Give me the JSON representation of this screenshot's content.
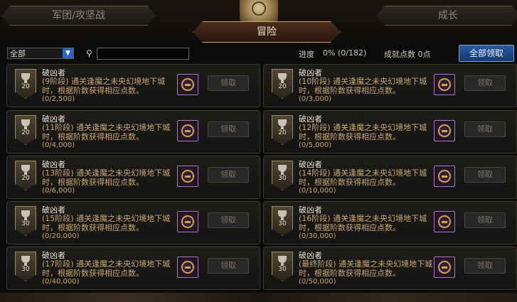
{
  "header": {
    "tab_left": "军团/攻坚战",
    "tab_right": "成长",
    "tab_active": "冒险"
  },
  "filter": {
    "select_value": "全部",
    "search_value": ""
  },
  "stats": {
    "progress_label": "进度",
    "progress_value": "0% (0/182)",
    "points_text": "成就点数 0点",
    "claim_all": "全部领取"
  },
  "cards": [
    {
      "title": "破凶者",
      "desc": "(9阶段) 通关逢魔之未央幻境地下城时，根据阶数获得相应点数。",
      "progress": "(0/2,500)",
      "badge": "20",
      "button": "领取"
    },
    {
      "title": "破凶者",
      "desc": "(10阶段) 通关逢魔之未央幻境地下城时，根据阶数获得相应点数。",
      "progress": "(0/3,000)",
      "badge": "20",
      "button": "领取"
    },
    {
      "title": "破凶者",
      "desc": "(11阶段) 通关逢魔之未央幻境地下城时，根据阶数获得相应点数。",
      "progress": "(0/4,000)",
      "badge": "20",
      "button": "领取"
    },
    {
      "title": "破凶者",
      "desc": "(12阶段) 通关逢魔之未央幻境地下城时，根据阶数获得相应点数。",
      "progress": "(0/5,000)",
      "badge": "20",
      "button": "领取"
    },
    {
      "title": "破凶者",
      "desc": "(13阶段) 通关逢魔之未央幻境地下城时，根据阶数获得相应点数。",
      "progress": "(0/6,000)",
      "badge": "20",
      "button": "领取"
    },
    {
      "title": "破凶者",
      "desc": "(14阶段) 通关逢魔之未央幻境地下城时，根据阶数获得相应点数。",
      "progress": "(0/10,000)",
      "badge": "30",
      "button": "领取"
    },
    {
      "title": "破凶者",
      "desc": "(15阶段) 通关逢魔之未央幻境地下城时，根据阶数获得相应点数。",
      "progress": "(0/20,000)",
      "badge": "30",
      "button": "领取"
    },
    {
      "title": "破凶者",
      "desc": "(16阶段) 通关逢魔之未央幻境地下城时，根据阶数获得相应点数。",
      "progress": "(0/30,000)",
      "badge": "30",
      "button": "领取"
    },
    {
      "title": "破凶者",
      "desc": "(17阶段) 通关逢魔之未央幻境地下城时，根据阶数获得相应点数。",
      "progress": "(0/40,000)",
      "badge": "30",
      "button": "领取"
    },
    {
      "title": "破凶者",
      "desc": "(最终阶段) 通关逢魔之未央幻境地下城时，根据阶数获得相应点数。",
      "progress": "(0/50,000)",
      "badge": "30",
      "button": "领取"
    }
  ]
}
